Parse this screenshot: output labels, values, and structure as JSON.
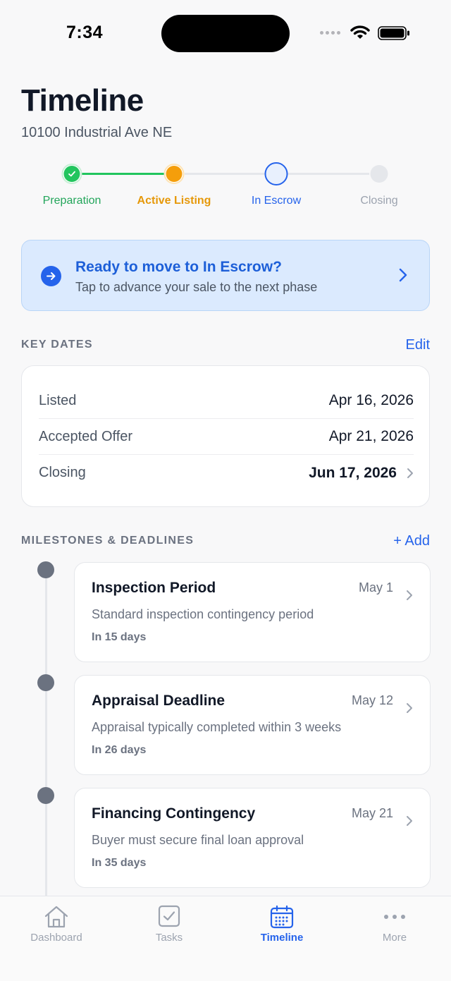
{
  "status_bar": {
    "time": "7:34"
  },
  "header": {
    "title": "Timeline",
    "address": "10100 Industrial Ave NE"
  },
  "stepper": {
    "steps": [
      {
        "label": "Preparation",
        "state": "complete"
      },
      {
        "label": "Active Listing",
        "state": "current"
      },
      {
        "label": "In Escrow",
        "state": "next"
      },
      {
        "label": "Closing",
        "state": "upcoming"
      }
    ],
    "colors": {
      "complete": "#22c55e",
      "current": "#f59e0b",
      "next": "#2563eb",
      "upcoming": "#d1d5db"
    }
  },
  "banner": {
    "title": "Ready to move to In Escrow?",
    "subtitle": "Tap to advance your sale to the next phase"
  },
  "key_dates": {
    "header": "KEY DATES",
    "action": "Edit",
    "rows": [
      {
        "label": "Listed",
        "value": "Apr 16, 2026"
      },
      {
        "label": "Accepted Offer",
        "value": "Apr 21, 2026"
      },
      {
        "label": "Closing",
        "value": "Jun 17, 2026"
      }
    ]
  },
  "milestones": {
    "header": "MILESTONES & DEADLINES",
    "action": "+ Add",
    "items": [
      {
        "title": "Inspection Period",
        "date": "May 1",
        "description": "Standard inspection contingency period",
        "due": "In 15 days"
      },
      {
        "title": "Appraisal Deadline",
        "date": "May 12",
        "description": "Appraisal typically completed within 3 weeks",
        "due": "In 26 days"
      },
      {
        "title": "Financing Contingency",
        "date": "May 21",
        "description": "Buyer must secure final loan approval",
        "due": "In 35 days"
      }
    ]
  },
  "tabs": [
    {
      "label": "Dashboard",
      "icon": "house-icon"
    },
    {
      "label": "Tasks",
      "icon": "checkbox-icon"
    },
    {
      "label": "Timeline",
      "icon": "calendar-icon",
      "active": true
    },
    {
      "label": "More",
      "icon": "ellipsis-icon"
    }
  ],
  "theme": {
    "accent": "#2563eb",
    "text": "#111827",
    "muted": "#6b7280"
  }
}
